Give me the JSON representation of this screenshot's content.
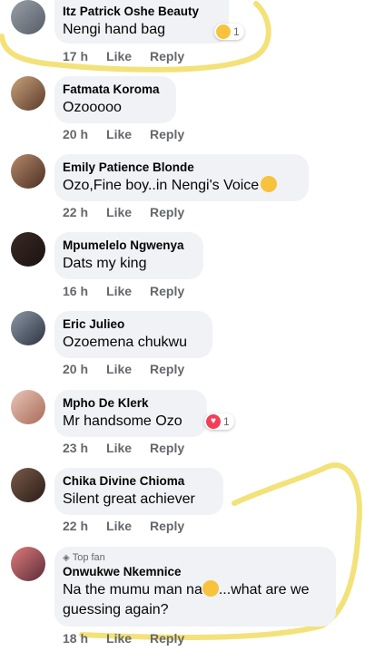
{
  "comments": [
    {
      "name": "Itz Patrick Oshe Beauty",
      "text": "Nengi hand bag",
      "time": "17 h",
      "like": "Like",
      "reply": "Reply",
      "reaction_count": "1"
    },
    {
      "name": "Fatmata Koroma",
      "text": "Ozooooo",
      "time": "20 h",
      "like": "Like",
      "reply": "Reply"
    },
    {
      "name": "Emily Patience Blonde",
      "text": "Ozo,Fine boy..in Nengi's Voice",
      "time": "22 h",
      "like": "Like",
      "reply": "Reply"
    },
    {
      "name": "Mpumelelo Ngwenya",
      "text": "Dats my king",
      "time": "16 h",
      "like": "Like",
      "reply": "Reply"
    },
    {
      "name": "Eric Julieo",
      "text": "Ozoemena chukwu",
      "time": "20 h",
      "like": "Like",
      "reply": "Reply"
    },
    {
      "name": "Mpho De Klerk",
      "text": "Mr handsome Ozo",
      "time": "23 h",
      "like": "Like",
      "reply": "Reply",
      "reaction_count": "1"
    },
    {
      "name": "Chika Divine Chioma",
      "text": "Silent great achiever",
      "time": "22 h",
      "like": "Like",
      "reply": "Reply"
    },
    {
      "badge": "Top fan",
      "name": "Onwukwe Nkemnice",
      "text_before": "Na the mumu man na",
      "text_after": "...what are we",
      "text_line2": "guessing again?",
      "time": "18 h",
      "like": "Like",
      "reply": "Reply"
    }
  ],
  "colors": {
    "bubble": "#f0f2f5",
    "highlight": "#f3e27a",
    "meta": "#65676b"
  }
}
